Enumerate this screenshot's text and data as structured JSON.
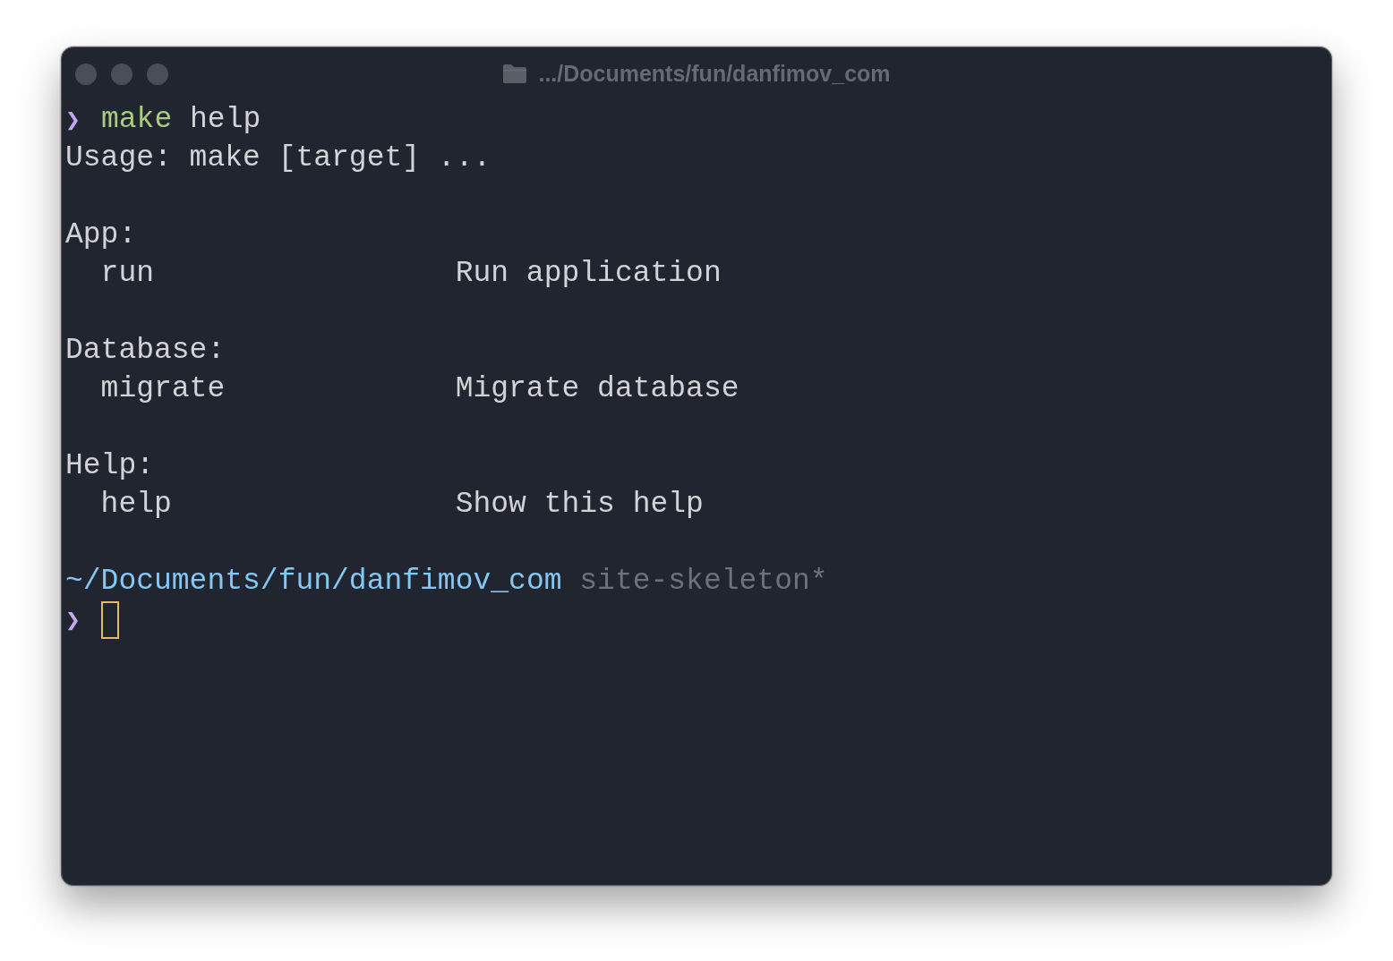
{
  "window": {
    "title": ".../Documents/fun/danfimov_com",
    "focused": false
  },
  "lines": [
    {
      "kind": "command",
      "prompt": "❯",
      "command": "make",
      "args": "help"
    },
    {
      "kind": "output",
      "text": "Usage: make [target] ..."
    },
    {
      "kind": "blank"
    },
    {
      "kind": "heading",
      "text": "App:"
    },
    {
      "kind": "target",
      "name": "run",
      "description": "Run application"
    },
    {
      "kind": "blank"
    },
    {
      "kind": "heading",
      "text": "Database:"
    },
    {
      "kind": "target",
      "name": "migrate",
      "description": "Migrate database"
    },
    {
      "kind": "blank"
    },
    {
      "kind": "heading",
      "text": "Help:"
    },
    {
      "kind": "target",
      "name": "help",
      "description": "Show this help"
    },
    {
      "kind": "blank"
    },
    {
      "kind": "path",
      "path": "~/Documents/fun/danfimov_com",
      "branch": "site-skeleton*"
    },
    {
      "kind": "input",
      "prompt": "❯"
    }
  ]
}
